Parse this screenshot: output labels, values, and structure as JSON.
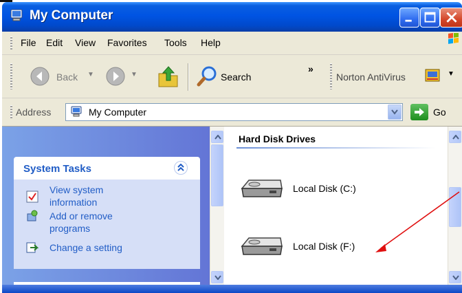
{
  "window": {
    "title": "My Computer",
    "controls": {
      "minimize": "minimize",
      "maximize": "maximize",
      "close": "close"
    }
  },
  "menubar": {
    "items": [
      {
        "label": "File"
      },
      {
        "label": "Edit"
      },
      {
        "label": "View"
      },
      {
        "label": "Favorites"
      },
      {
        "label": "Tools"
      },
      {
        "label": "Help"
      }
    ]
  },
  "toolbar": {
    "back_label": "Back",
    "search_label": "Search",
    "overflow_label": "»",
    "norton_label": "Norton AntiVirus"
  },
  "addressbar": {
    "label": "Address",
    "value": "My Computer",
    "go_label": "Go"
  },
  "taskpane": {
    "section_title": "System Tasks",
    "links": [
      {
        "label": "View system\ninformation",
        "icon": "system-info-icon"
      },
      {
        "label": "Add or remove\nprograms",
        "icon": "add-remove-icon"
      },
      {
        "label": "Change a setting",
        "icon": "control-panel-icon"
      }
    ]
  },
  "content": {
    "group_title": "Hard Disk Drives",
    "drives": [
      {
        "label": "Local Disk (C:)",
        "icon": "hard-disk-icon"
      },
      {
        "label": "Local Disk (F:)",
        "icon": "hard-disk-icon"
      }
    ]
  },
  "colors": {
    "xp_blue": "#0054e3",
    "taskpane_link": "#215dc6",
    "annotation_arrow": "#e01010"
  }
}
